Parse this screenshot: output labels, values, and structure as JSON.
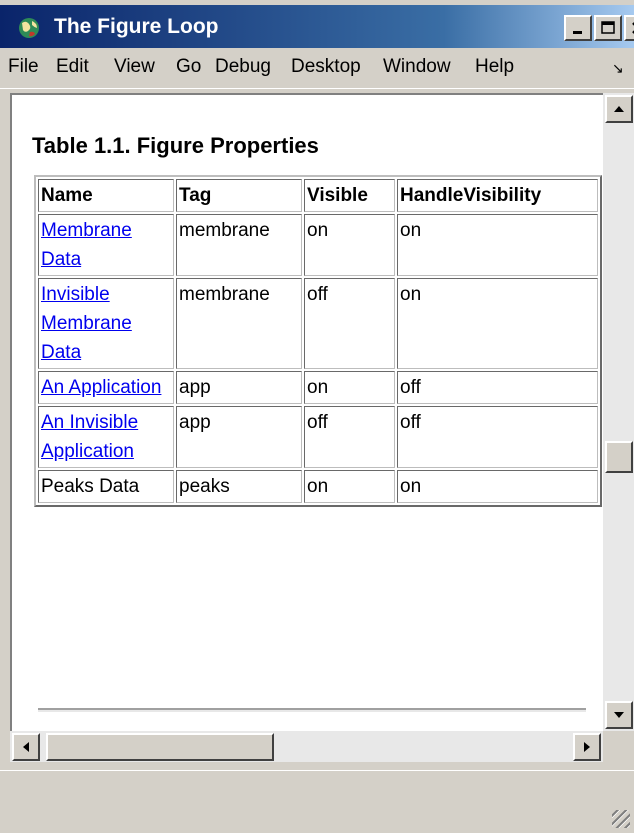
{
  "window": {
    "title": "The Figure Loop"
  },
  "menu": [
    "File",
    "Edit",
    "View",
    "Go",
    "Debug",
    "Desktop",
    "Window",
    "Help"
  ],
  "content": {
    "table_title": "Table 1.1. Figure Properties",
    "table": {
      "headers": [
        "Name",
        "Tag",
        "Visible",
        "HandleVisibility"
      ],
      "rows": [
        {
          "name": "Membrane Data",
          "name_is_link": true,
          "tag": "membrane",
          "visible": "on",
          "handle_visibility": "on"
        },
        {
          "name": "Invisible Membrane Data",
          "name_is_link": true,
          "tag": "membrane",
          "visible": "off",
          "handle_visibility": "on"
        },
        {
          "name": "An Application",
          "name_is_link": true,
          "tag": "app",
          "visible": "on",
          "handle_visibility": "off"
        },
        {
          "name": "An Invisible Application",
          "name_is_link": true,
          "tag": "app",
          "visible": "off",
          "handle_visibility": "off"
        },
        {
          "name": "Peaks Data",
          "name_is_link": false,
          "tag": "peaks",
          "visible": "on",
          "handle_visibility": "on"
        }
      ]
    }
  },
  "colors": {
    "titlebar": "#0a246a",
    "link": "#0000ee",
    "chrome": "#d4d0c8"
  },
  "icons": [
    "app-globe-icon",
    "minimize-icon",
    "maximize-icon",
    "close-icon",
    "menu-overflow-chevron-icon",
    "scroll-up-arrow-icon",
    "scroll-down-arrow-icon",
    "scroll-left-arrow-icon",
    "scroll-right-arrow-icon",
    "resize-grip-icon"
  ],
  "scroll": {
    "vertical_position": 0.56,
    "horizontal_position": 0.0
  }
}
